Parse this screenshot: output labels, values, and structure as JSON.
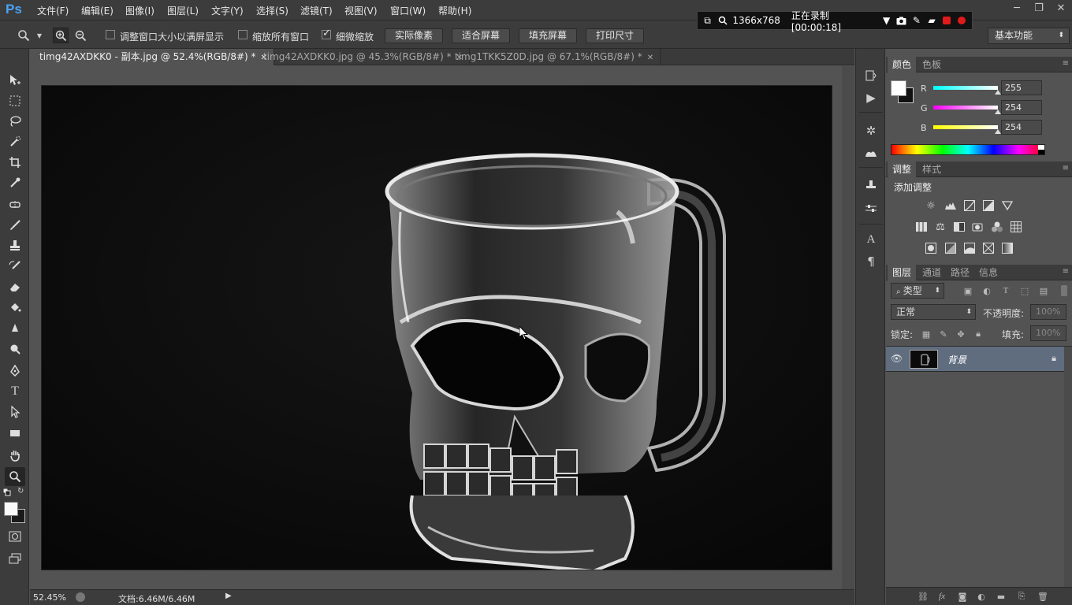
{
  "app": {
    "logo": "Ps"
  },
  "menu": [
    "文件(F)",
    "编辑(E)",
    "图像(I)",
    "图层(L)",
    "文字(Y)",
    "选择(S)",
    "滤镜(T)",
    "视图(V)",
    "窗口(W)",
    "帮助(H)"
  ],
  "recorder": {
    "resolution": "1366x768",
    "status": "正在录制 [00:00:18]"
  },
  "options": {
    "resize_windows_label": "调整窗口大小以满屏显示",
    "resize_windows_checked": false,
    "zoom_all_label": "缩放所有窗口",
    "zoom_all_checked": false,
    "scrubby_label": "细微缩放",
    "scrubby_checked": true,
    "btn_actual": "实际像素",
    "btn_fit": "适合屏幕",
    "btn_fill": "填充屏幕",
    "btn_print": "打印尺寸",
    "workspace": "基本功能"
  },
  "tabs": [
    {
      "title": "timg42AXDKK0 - 副本.jpg @ 52.4%(RGB/8#) *",
      "active": true
    },
    {
      "title": "timg42AXDKK0.jpg @ 45.3%(RGB/8#) *",
      "active": false
    },
    {
      "title": "timg1TKK5Z0D.jpg @ 67.1%(RGB/8#) *",
      "active": false
    }
  ],
  "status": {
    "zoom": "52.45%",
    "doc": "文档:6.46M/6.46M"
  },
  "color_panel": {
    "tabs": [
      "颜色",
      "色板"
    ],
    "r_label": "R",
    "g_label": "G",
    "b_label": "B",
    "r": "255",
    "g": "254",
    "b": "254"
  },
  "adjust_panel": {
    "tabs": [
      "调整",
      "样式"
    ],
    "title": "添加调整"
  },
  "layers_panel": {
    "tabs": [
      "图层",
      "通道",
      "路径",
      "信息"
    ],
    "filter": "类型",
    "blend_mode": "正常",
    "opacity_label": "不透明度:",
    "opacity": "100%",
    "lock_label": "锁定:",
    "fill_label": "填充:",
    "fill": "100%",
    "layers": [
      {
        "name": "背景",
        "visible": true,
        "locked": true
      }
    ]
  },
  "colors": {
    "accent": "#4aa3f5",
    "record": "#e01a1a",
    "panel_bg": "#535353",
    "chrome": "#3c3c3c"
  }
}
